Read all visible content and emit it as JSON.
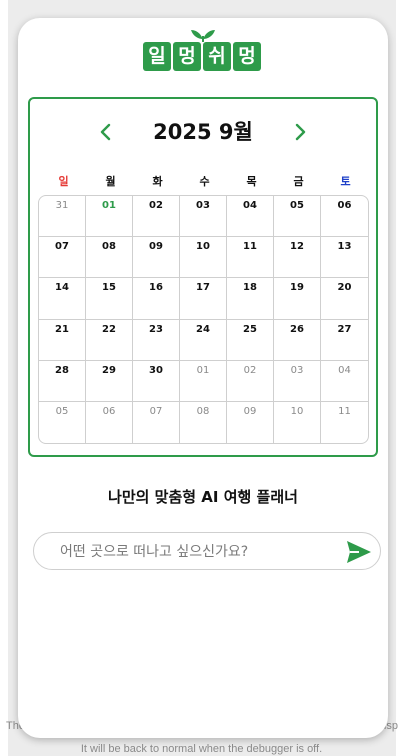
{
  "app": {
    "logo_chars": [
      "일",
      "멍",
      "쉬",
      "멍"
    ],
    "brand_color": "#2e9b4a"
  },
  "calendar": {
    "title": "2025 9월",
    "prev_icon": "chevron-left-icon",
    "next_icon": "chevron-right-icon",
    "weekdays": [
      "일",
      "월",
      "화",
      "수",
      "목",
      "금",
      "토"
    ],
    "days": [
      {
        "label": "31",
        "current": false
      },
      {
        "label": "01",
        "current": true,
        "today": true
      },
      {
        "label": "02",
        "current": true
      },
      {
        "label": "03",
        "current": true
      },
      {
        "label": "04",
        "current": true
      },
      {
        "label": "05",
        "current": true
      },
      {
        "label": "06",
        "current": true
      },
      {
        "label": "07",
        "current": true
      },
      {
        "label": "08",
        "current": true
      },
      {
        "label": "09",
        "current": true
      },
      {
        "label": "10",
        "current": true
      },
      {
        "label": "11",
        "current": true
      },
      {
        "label": "12",
        "current": true
      },
      {
        "label": "13",
        "current": true
      },
      {
        "label": "14",
        "current": true
      },
      {
        "label": "15",
        "current": true
      },
      {
        "label": "16",
        "current": true
      },
      {
        "label": "17",
        "current": true
      },
      {
        "label": "18",
        "current": true
      },
      {
        "label": "19",
        "current": true
      },
      {
        "label": "20",
        "current": true
      },
      {
        "label": "21",
        "current": true
      },
      {
        "label": "22",
        "current": true
      },
      {
        "label": "23",
        "current": true
      },
      {
        "label": "24",
        "current": true
      },
      {
        "label": "25",
        "current": true
      },
      {
        "label": "26",
        "current": true
      },
      {
        "label": "27",
        "current": true
      },
      {
        "label": "28",
        "current": true
      },
      {
        "label": "29",
        "current": true
      },
      {
        "label": "30",
        "current": true
      },
      {
        "label": "01",
        "current": false
      },
      {
        "label": "02",
        "current": false
      },
      {
        "label": "03",
        "current": false
      },
      {
        "label": "04",
        "current": false
      },
      {
        "label": "05",
        "current": false
      },
      {
        "label": "06",
        "current": false
      },
      {
        "label": "07",
        "current": false
      },
      {
        "label": "08",
        "current": false
      },
      {
        "label": "09",
        "current": false
      },
      {
        "label": "10",
        "current": false
      },
      {
        "label": "11",
        "current": false
      }
    ]
  },
  "main": {
    "tagline": "나만의 맞춤형 AI 여행 플래너",
    "search_placeholder": "어떤 곳으로 떠나고 싶으신가요?",
    "send_icon": "send-icon"
  },
  "debugger": {
    "line1": "The",
    "line1_end": "disp",
    "line2": "It will be back to normal when the debugger is off."
  }
}
